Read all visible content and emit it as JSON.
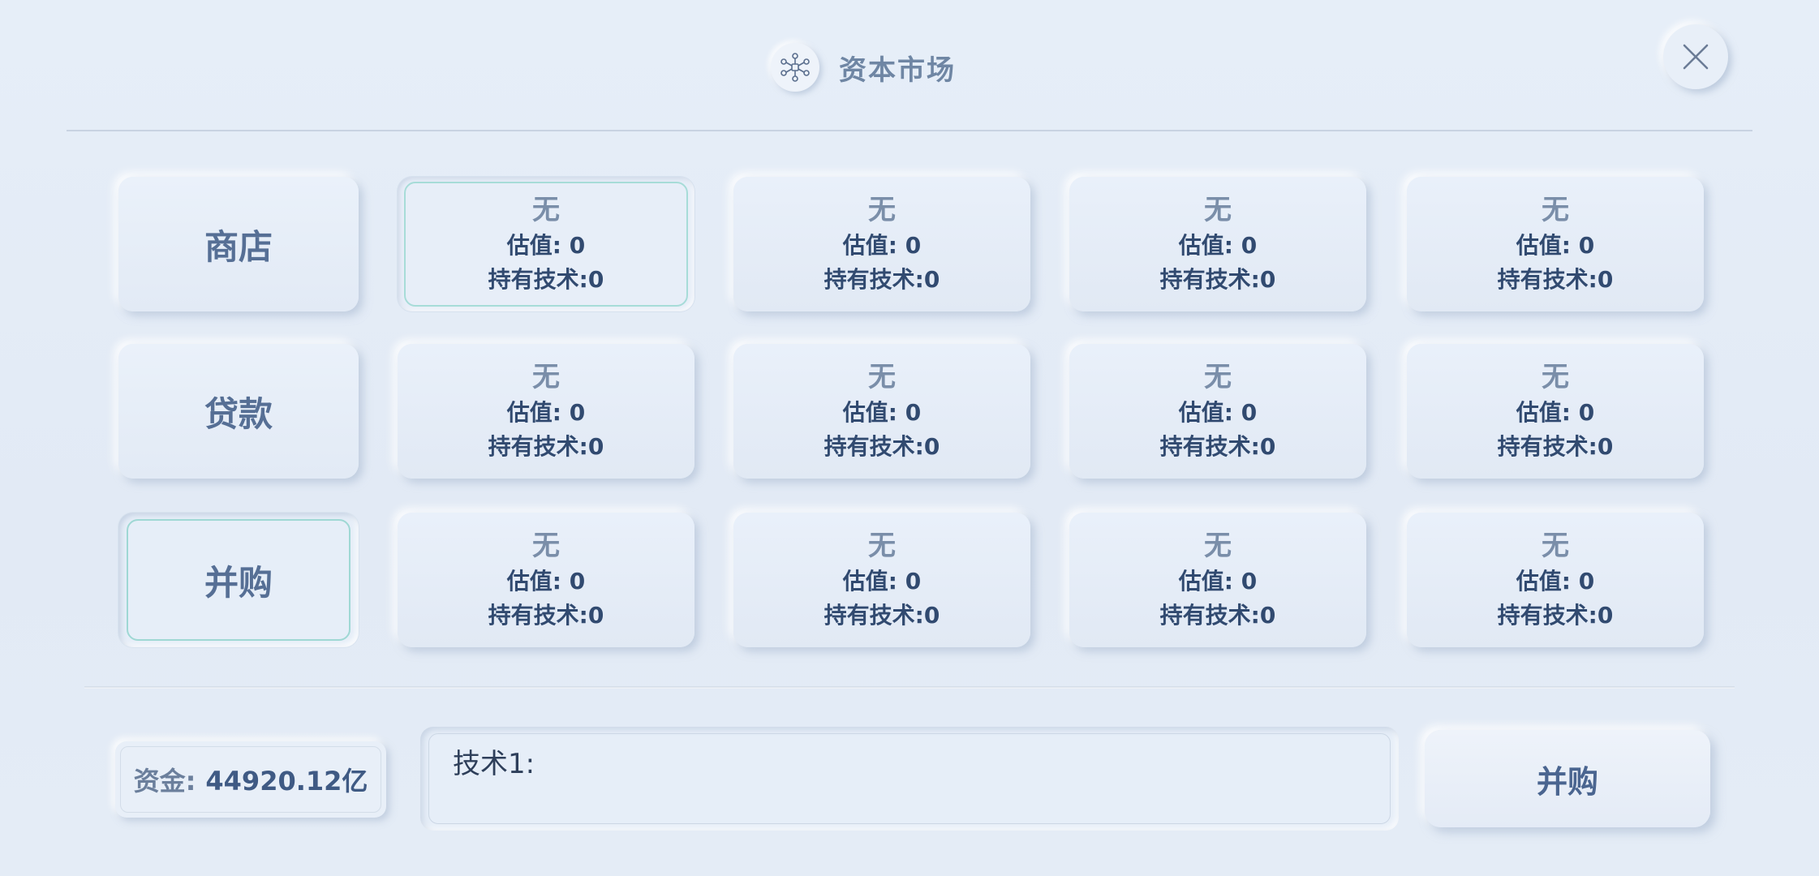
{
  "header": {
    "title": "资本市场",
    "icon": "network-hub-icon",
    "close_icon": "close-icon"
  },
  "sidebar": {
    "items": [
      {
        "label": "商店",
        "active": false
      },
      {
        "label": "贷款",
        "active": false
      },
      {
        "label": "并购",
        "active": true
      }
    ]
  },
  "grid": {
    "rows": [
      [
        {
          "name": "无",
          "valuation": "估值: 0",
          "tech": "持有技术:0",
          "selected": true
        },
        {
          "name": "无",
          "valuation": "估值: 0",
          "tech": "持有技术:0"
        },
        {
          "name": "无",
          "valuation": "估值: 0",
          "tech": "持有技术:0"
        },
        {
          "name": "无",
          "valuation": "估值: 0",
          "tech": "持有技术:0"
        }
      ],
      [
        {
          "name": "无",
          "valuation": "估值: 0",
          "tech": "持有技术:0"
        },
        {
          "name": "无",
          "valuation": "估值: 0",
          "tech": "持有技术:0"
        },
        {
          "name": "无",
          "valuation": "估值: 0",
          "tech": "持有技术:0"
        },
        {
          "name": "无",
          "valuation": "估值: 0",
          "tech": "持有技术:0"
        }
      ],
      [
        {
          "name": "无",
          "valuation": "估值: 0",
          "tech": "持有技术:0"
        },
        {
          "name": "无",
          "valuation": "估值: 0",
          "tech": "持有技术:0"
        },
        {
          "name": "无",
          "valuation": "估值: 0",
          "tech": "持有技术:0"
        },
        {
          "name": "无",
          "valuation": "估值: 0",
          "tech": "持有技术:0"
        }
      ]
    ]
  },
  "footer": {
    "funds_label": "资金:",
    "funds_value": "44920.12亿",
    "tech_text": "技术1:",
    "action_label": "并购"
  },
  "colors": {
    "accent_selected": "#a7dcd8",
    "text_primary": "#314a70",
    "text_muted": "#7a8ea9"
  }
}
